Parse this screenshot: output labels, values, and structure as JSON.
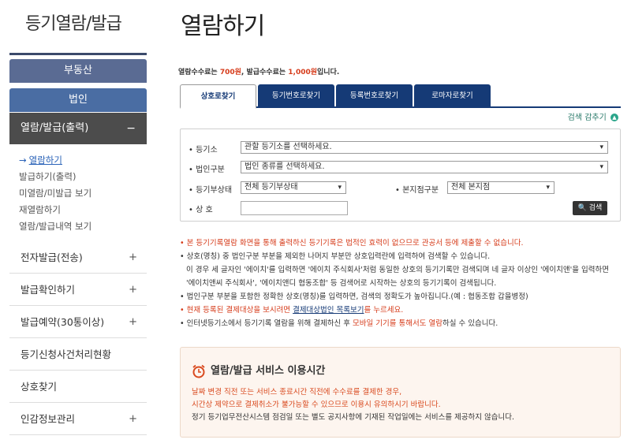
{
  "sidebar": {
    "title": "등기열람/발급",
    "realestate": "부동산",
    "corp": "법인",
    "open_section": "열람/발급(출력)",
    "open_toggle": "−",
    "submenu": [
      {
        "label": "열람하기",
        "active": true
      },
      {
        "label": "발급하기(출력)"
      },
      {
        "label": "미열람/미발급 보기"
      },
      {
        "label": "재열람하기"
      },
      {
        "label": "열람/발급내역 보기"
      }
    ],
    "items": [
      {
        "label": "전자발급(전송)",
        "plus": "+"
      },
      {
        "label": "발급확인하기",
        "plus": "+"
      },
      {
        "label": "발급예약(30통이상)",
        "plus": "+"
      },
      {
        "label": "등기신청사건처리현황",
        "plus": ""
      },
      {
        "label": "상호찾기",
        "plus": ""
      },
      {
        "label": "인감정보관리",
        "plus": "+"
      }
    ]
  },
  "main": {
    "title": "열람하기",
    "fee": {
      "prefix": "열람수수료는 ",
      "view_fee": "700원",
      "mid": ", 발급수수료는 ",
      "issue_fee": "1,000원",
      "suffix": "입니다."
    },
    "tabs": [
      {
        "label": "상호로찾기",
        "active": true
      },
      {
        "label": "등기번호로찾기"
      },
      {
        "label": "등록번호로찾기"
      },
      {
        "label": "로마자로찾기"
      }
    ],
    "toggle_label": "검색 감추기",
    "form": {
      "registry_label": "• 등기소",
      "registry_value": "관할 등기소를 선택하세요.",
      "corp_type_label": "• 법인구분",
      "corp_type_value": "법인 종류를 선택하세요.",
      "status_label": "• 등기부상태",
      "status_value": "전체 등기부상태",
      "branch_label": "• 본지점구분",
      "branch_value": "전체 본지점",
      "name_label": "• 상 호",
      "name_value": "",
      "search_button": "검색"
    },
    "notes": {
      "n1": "• 본 등기기록열람 화면을 통해 출력하신 등기기록은 법적인 효력이 없으므로 관공서 등에 제출할 수 없습니다.",
      "n2": "• 상호(명칭) 중 법인구분 부분을 제외한 나머지 부분만 상호입력란에 입력하여 검색할 수 있습니다.",
      "n2b": "이 경우 세 글자인 '에이치'를 입력하면 '에이치 주식회사'처럼 동일한 상호의 등기기록만 검색되며 네 글자 이상인 '에이치앤'을 입력하면",
      "n2c": "'에이치앤씨 주식회사', '에이치앤디 협동조합' 등 검색어로 시작하는 상호의 등기기록이 검색됩니다.",
      "n3": "• 법인구분 부분을 포함한 정확한 상호(명칭)를 입력하면, 검색의 정확도가 높아집니다.(예 : 협동조합 갑을병정)",
      "n4_pre": "• 현재 등록된 결제대상을 보시려면 ",
      "n4_link": "결제대상법인 목록보기",
      "n4_post": "를 누르세요.",
      "n5_pre": "• 인터넷등기소에서 등기기록 열람을 위해 결제하신 후 ",
      "n5_red": "모바일 기기를 통해서도 열람",
      "n5_post": "하실 수 있습니다."
    },
    "hours": {
      "title": "열람/발급 서비스 이용시간",
      "line1": "날짜 변경 직전 또는 서비스 종료시간 직전에 수수료를 결제한 경우,",
      "line2": "시간상 제약으로 결제취소가 불가능할 수 있으므로 이용시 유의하시기 바랍니다.",
      "line3": "정기 등기업무전산시스템 점검일 또는 별도 공지사항에 기재된 작업일에는 서비스를 제공하지 않습니다."
    }
  }
}
